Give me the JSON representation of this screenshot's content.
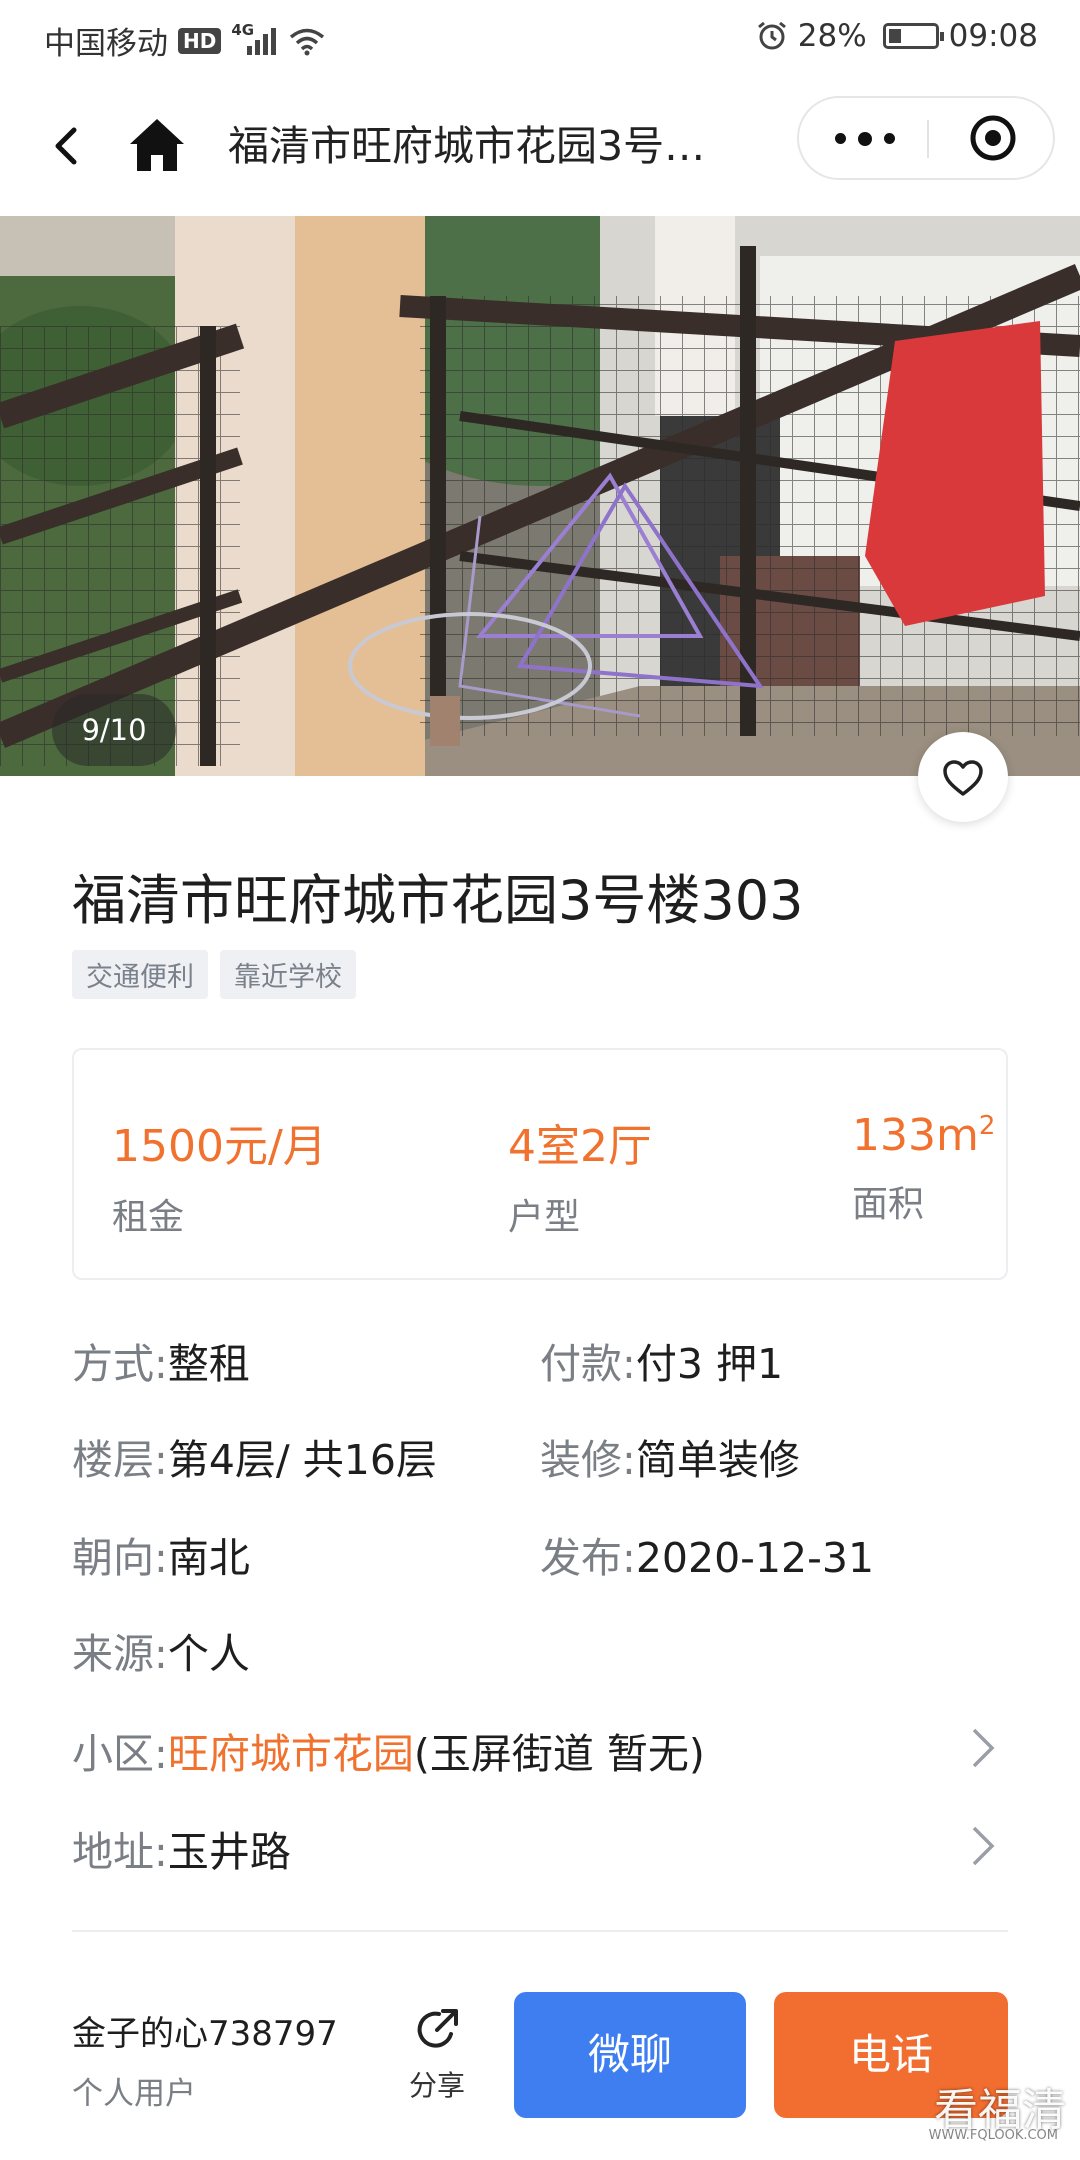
{
  "status_bar": {
    "carrier": "中国移动",
    "hd": "HD",
    "network": "4G",
    "battery": "28%",
    "battery_level": 0.28,
    "time": "09:08"
  },
  "nav": {
    "title": "福清市旺府城市花园3号…"
  },
  "gallery": {
    "counter": "9/10"
  },
  "listing": {
    "title": "福清市旺府城市花园3号楼303",
    "tags": [
      "交通便利",
      "靠近学校"
    ]
  },
  "summary": {
    "rent_value": "1500元/月",
    "rent_label": "租金",
    "layout_value": "4室2厅",
    "layout_label": "户型",
    "area_value": "133m",
    "area_unit_sup": "2",
    "area_label": "面积"
  },
  "details": {
    "mode_key": "方式:",
    "mode_val": "整租",
    "payment_key": "付款:",
    "payment_val": "付3  押1",
    "floor_key": "楼层:",
    "floor_val": "第4层/ 共16层",
    "decoration_key": "装修:",
    "decoration_val": "简单装修",
    "orientation_key": "朝向:",
    "orientation_val": "南北",
    "published_key": "发布:",
    "published_val": "2020-12-31",
    "source_key": "来源:",
    "source_val": "个人",
    "community_key": "小区:",
    "community_name": "旺府城市花园",
    "community_extra": "(玉屏街道  暂无)",
    "address_key": "地址:",
    "address_val": "玉井路"
  },
  "bottom_bar": {
    "user_name": "金子的心738797",
    "user_type": "个人用户",
    "share_label": "分享",
    "chat_label": "微聊",
    "call_label": "电话"
  },
  "watermark": {
    "text": "看福清",
    "sub": "WWW.FQLOOK.COM"
  },
  "colors": {
    "accent_orange": "#f0722e",
    "chat_blue": "#3f7ef1",
    "call_orange": "#f26d30"
  }
}
